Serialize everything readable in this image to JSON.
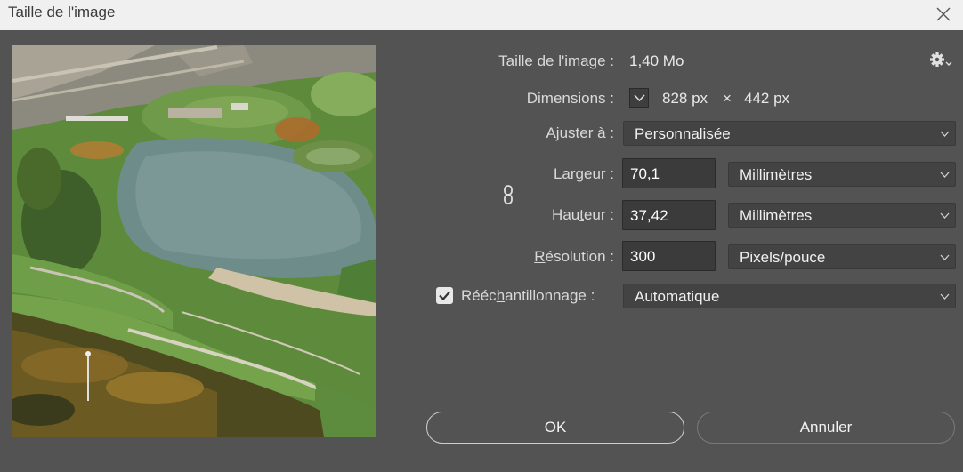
{
  "window": {
    "title": "Taille de l'image"
  },
  "image_size": {
    "label": "Taille de l'image :",
    "value": "1,40 Mo"
  },
  "dimensions": {
    "label": "Dimensions :",
    "width": "828 px",
    "times": "×",
    "height": "442 px"
  },
  "fit_to": {
    "label": "Ajuster à :",
    "value": "Personnalisée"
  },
  "width": {
    "label_pre": "Larg",
    "label_u": "e",
    "label_post": "ur :",
    "value": "70,1",
    "unit": "Millimètres"
  },
  "height": {
    "label_pre": "Hau",
    "label_u": "t",
    "label_post": "eur :",
    "value": "37,42",
    "unit": "Millimètres"
  },
  "resolution": {
    "label_pre": "",
    "label_u": "R",
    "label_post": "ésolution :",
    "value": "300",
    "unit": "Pixels/pouce"
  },
  "resample": {
    "checked": true,
    "label_pre": "Rééc",
    "label_u": "h",
    "label_post": "antillonnage :",
    "value": "Automatique"
  },
  "buttons": {
    "ok": "OK",
    "cancel": "Annuler"
  },
  "icons": {
    "close": "close-icon",
    "gear": "gear-icon",
    "chevron": "chevron-down-icon",
    "link": "link-chain-icon",
    "check": "checkmark-icon"
  },
  "colors": {
    "dialog_bg": "#535353",
    "titlebar_bg": "#f0f0f0",
    "field_bg": "#3b3b3b",
    "select_bg": "#434343"
  }
}
